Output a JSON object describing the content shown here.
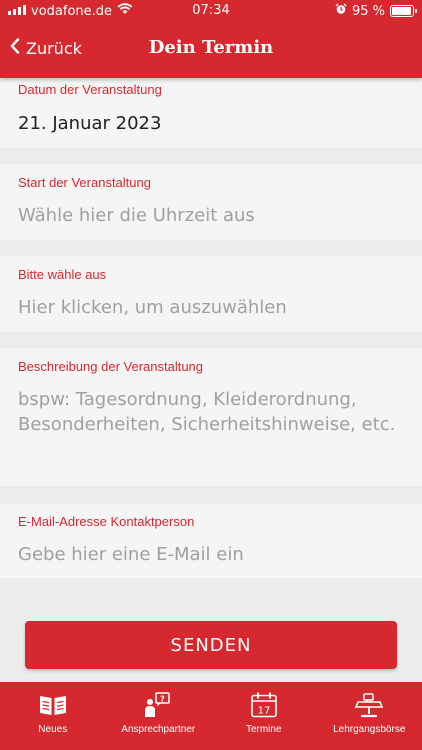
{
  "status_bar": {
    "carrier": "vodafone.de",
    "time": "07:34",
    "battery_percent": "95 %",
    "battery_level": 0.95
  },
  "nav": {
    "back_label": "Zurück",
    "title": "Dein Termin"
  },
  "form": {
    "date": {
      "label": "Datum der Veranstaltung",
      "value": "21. Januar 2023"
    },
    "start": {
      "label": "Start der Veranstaltung",
      "placeholder": "Wähle hier die Uhrzeit aus"
    },
    "select": {
      "label": "Bitte wähle aus",
      "placeholder": "Hier klicken, um auszuwählen"
    },
    "description": {
      "label": "Beschreibung der Veranstaltung",
      "placeholder": "bspw: Tagesordnung, Kleiderordnung, Besonderheiten, Sicherheitshinweise, etc."
    },
    "email": {
      "label": "E-Mail-Adresse Kontaktperson",
      "placeholder": "Gebe hier eine E-Mail ein"
    },
    "submit_label": "SENDEN"
  },
  "tabs": [
    {
      "label": "Neues",
      "icon": "book-icon"
    },
    {
      "label": "Ansprechpartner",
      "icon": "contact-person-icon"
    },
    {
      "label": "Termine",
      "icon": "calendar-icon",
      "day": "17"
    },
    {
      "label": "Lehrgangsbörse",
      "icon": "lectern-icon"
    }
  ],
  "colors": {
    "accent": "#d6282f",
    "field_bg": "#f5f5f5",
    "page_bg": "#ececec",
    "placeholder": "#a0a0a0"
  }
}
